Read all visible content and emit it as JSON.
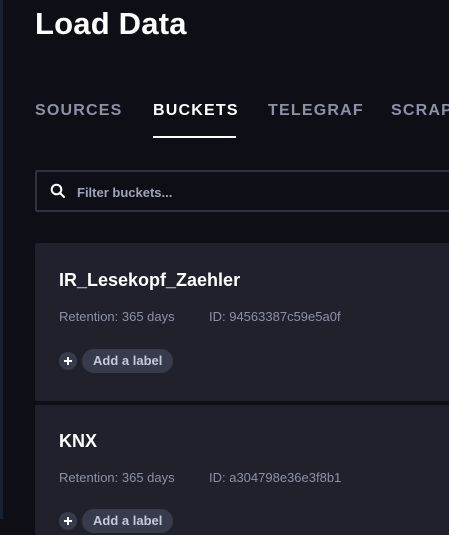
{
  "page": {
    "title": "Load Data"
  },
  "tabs": [
    {
      "label": "SOURCES",
      "active": false
    },
    {
      "label": "BUCKETS",
      "active": true
    },
    {
      "label": "TELEGRAF",
      "active": false
    },
    {
      "label": "SCRAPERS",
      "active": false
    }
  ],
  "search": {
    "placeholder": "Filter buckets...",
    "value": "",
    "icon": "search-icon"
  },
  "buckets": [
    {
      "name": "IR_Lesekopf_Zaehler",
      "retention": "Retention: 365 days",
      "id": "ID: 94563387c59e5a0f",
      "add_label": "Add a label"
    },
    {
      "name": "KNX",
      "retention": "Retention: 365 days",
      "id": "ID: a304798e36e3f8b1",
      "add_label": "Add a label"
    }
  ],
  "colors": {
    "background": "#0e0e16",
    "card": "#20212d",
    "pill": "#383b4b",
    "text_primary": "#ffffff",
    "text_muted": "#8d91a5"
  }
}
